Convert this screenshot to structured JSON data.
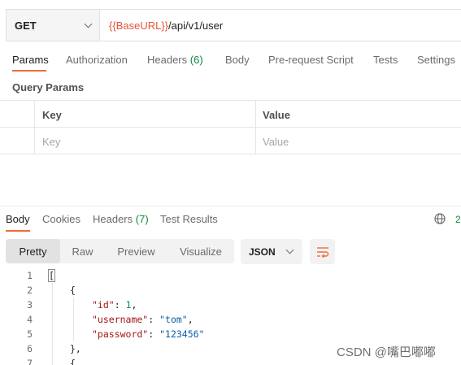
{
  "request": {
    "method": "GET",
    "url_variable": "{{BaseURL}}",
    "url_path": "/api/v1/user"
  },
  "request_tabs": {
    "params": "Params",
    "authorization": "Authorization",
    "headers": "Headers",
    "headers_count": "(6)",
    "body": "Body",
    "prerequest": "Pre-request Script",
    "tests": "Tests",
    "settings": "Settings"
  },
  "query_params": {
    "title": "Query Params",
    "col_key": "Key",
    "col_value": "Value",
    "key_placeholder": "Key",
    "value_placeholder": "Value"
  },
  "response_tabs": {
    "body": "Body",
    "cookies": "Cookies",
    "headers": "Headers",
    "headers_count": "(7)",
    "test_results": "Test Results",
    "status_partial": "2"
  },
  "format_tabs": {
    "pretty": "Pretty",
    "raw": "Raw",
    "preview": "Preview",
    "visualize": "Visualize",
    "language": "JSON"
  },
  "code_lines": {
    "n1": "1",
    "n2": "2",
    "n3": "3",
    "n4": "4",
    "n5": "5",
    "n6": "6",
    "n7": "7",
    "l1": "[",
    "l2": "{",
    "id_key": "\"id\"",
    "id_val": "1",
    "username_key": "\"username\"",
    "username_val": "\"tom\"",
    "password_key": "\"password\"",
    "password_val": "\"123456\"",
    "l6": "},",
    "l7": "{"
  },
  "watermark": "CSDN @嘴巴嘟嘟",
  "colors": {
    "accent": "#f26b3a",
    "url_variable": "#e6543a",
    "count_green": "#0a8a3a",
    "json_key": "#a31515",
    "json_string": "#0b5ea8",
    "json_number": "#098658"
  }
}
